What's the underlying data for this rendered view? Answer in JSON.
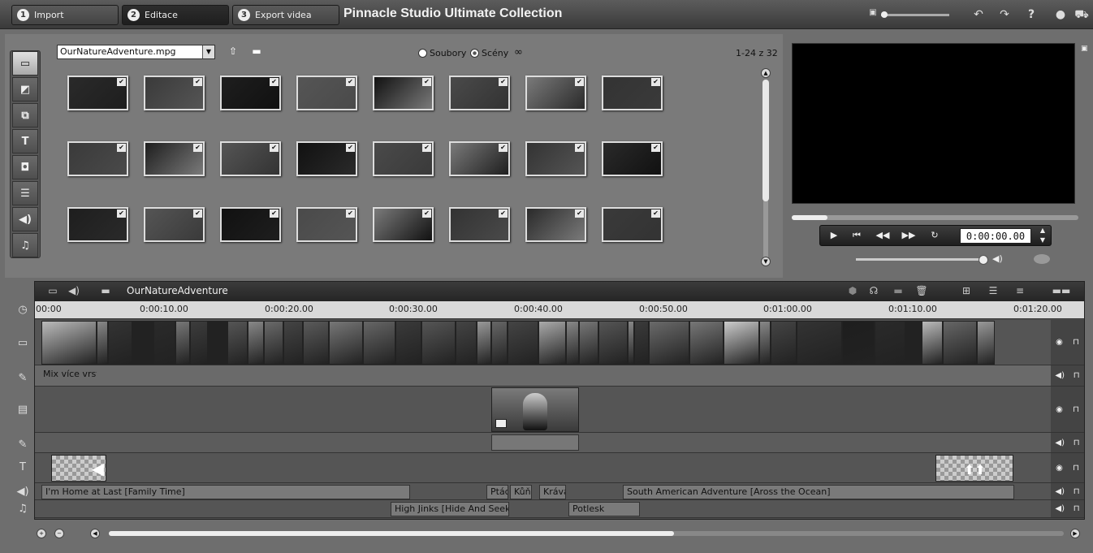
{
  "app": {
    "title": "Pinnacle Studio Ultimate Collection",
    "steps": [
      {
        "num": "1",
        "label": "Import"
      },
      {
        "num": "2",
        "label": "Editace"
      },
      {
        "num": "3",
        "label": "Export videa"
      }
    ]
  },
  "library": {
    "file": "OurNatureAdventure.mpg",
    "view_files": "Soubory",
    "view_scenes": "Scény",
    "selected_view": "Scény",
    "count": "1-24 z 32",
    "thumb_count": 24,
    "categories": [
      "video-clips",
      "transitions",
      "effects",
      "titles",
      "photos",
      "menus",
      "sound-effects",
      "music"
    ]
  },
  "player": {
    "timecode": "0:00:00.00"
  },
  "timeline": {
    "project_name": "OurNatureAdventure",
    "ruler_labels": [
      "00:00",
      "0:00:10.00",
      "0:00:20.00",
      "0:00:30.00",
      "0:00:40.00",
      "0:00:50.00",
      "0:01:00.00",
      "0:01:10.00",
      "0:01:20.00"
    ],
    "video_audio_label": "Mix více vrstev",
    "audio_clips": {
      "sound1": "I'm Home at Last [Family Time]",
      "sound2": "Ptác",
      "sound3": "Kůň",
      "sound4": "Kráva",
      "sound5": "South American Adventure [Aross the Ocean]",
      "music1": "High Jinks [Hide And Seek]",
      "music2": "Potlesk"
    }
  }
}
